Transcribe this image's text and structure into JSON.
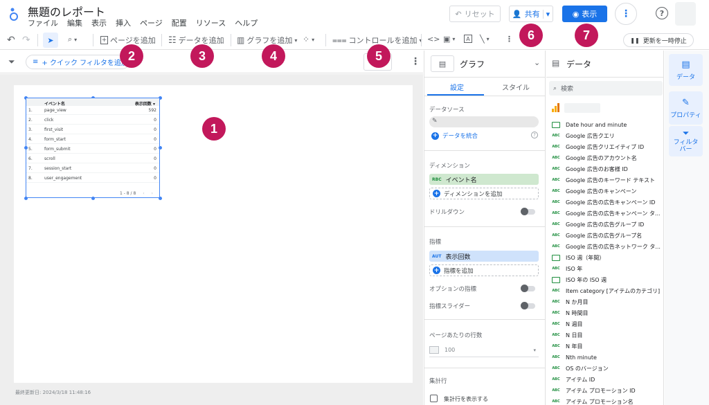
{
  "header": {
    "title": "無題のレポート",
    "menus": [
      "ファイル",
      "編集",
      "表示",
      "挿入",
      "ページ",
      "配置",
      "リソース",
      "ヘルプ"
    ],
    "reset_label": "リセット",
    "share_label": "共有",
    "view_label": "表示"
  },
  "toolbar": {
    "add_page": "ページを追加",
    "add_data": "データを追加",
    "add_chart": "グラフを追加",
    "add_control": "コントロールを追加",
    "pause_updates": "更新を一時停止"
  },
  "filterbar": {
    "quick_filter": "+ クイック フィルタを追加"
  },
  "canvas": {
    "last_updated": "最終更新日: 2024/3/18 11:48:16"
  },
  "table": {
    "headers": [
      "イベント名",
      "表示回数 ▾"
    ],
    "rows": [
      {
        "num": "1.",
        "name": "page_view",
        "value": "592"
      },
      {
        "num": "2.",
        "name": "click",
        "value": "0"
      },
      {
        "num": "3.",
        "name": "first_visit",
        "value": "0"
      },
      {
        "num": "4.",
        "name": "form_start",
        "value": "0"
      },
      {
        "num": "5.",
        "name": "form_submit",
        "value": "0"
      },
      {
        "num": "6.",
        "name": "scroll",
        "value": "0"
      },
      {
        "num": "7.",
        "name": "session_start",
        "value": "0"
      },
      {
        "num": "8.",
        "name": "user_engagement",
        "value": "0"
      }
    ],
    "pager": "1 - 8 / 8"
  },
  "badges": [
    "1",
    "2",
    "3",
    "4",
    "5",
    "6",
    "7"
  ],
  "properties": {
    "chart_type": "グラフ",
    "tab_setup": "設定",
    "tab_style": "スタイル",
    "data_source_label": "データソース",
    "blend_data": "データを統合",
    "dimension_label": "ディメンション",
    "dimension_type": "RBC",
    "dimension_value": "イベント名",
    "add_dimension": "ディメンションを追加",
    "drilldown": "ドリルダウン",
    "metric_label": "指標",
    "metric_type": "AUT",
    "metric_value": "表示回数",
    "add_metric": "指標を追加",
    "optional_metrics": "オプションの指標",
    "metric_slider": "指標スライダー",
    "rows_per_page_label": "ページあたりの行数",
    "rows_per_page_value": "100",
    "summary_row_label": "集計行",
    "show_summary_row": "集計行を表示する"
  },
  "data_panel": {
    "title": "データ",
    "search_placeholder": "検索",
    "fields": [
      {
        "type": "cal",
        "name": "Date hour and minute"
      },
      {
        "type": "ABC",
        "name": "Google 広告クエリ"
      },
      {
        "type": "ABC",
        "name": "Google 広告クリエイティブ ID"
      },
      {
        "type": "ABC",
        "name": "Google 広告のアカウント名"
      },
      {
        "type": "ABC",
        "name": "Google 広告のお客様 ID"
      },
      {
        "type": "ABC",
        "name": "Google 広告のキーワード テキスト"
      },
      {
        "type": "ABC",
        "name": "Google 広告のキャンペーン"
      },
      {
        "type": "ABC",
        "name": "Google 広告の広告キャンペーン ID"
      },
      {
        "type": "ABC",
        "name": "Google 広告の広告キャンペーン タ..."
      },
      {
        "type": "ABC",
        "name": "Google 広告の広告グループ ID"
      },
      {
        "type": "ABC",
        "name": "Google 広告の広告グループ名"
      },
      {
        "type": "ABC",
        "name": "Google 広告の広告ネットワーク タ..."
      },
      {
        "type": "cal",
        "name": "ISO 週（年間）"
      },
      {
        "type": "ABC",
        "name": "ISO 年"
      },
      {
        "type": "cal",
        "name": "ISO 年の ISO 週"
      },
      {
        "type": "ABC",
        "name": "Item category [アイテムのカテゴリ]"
      },
      {
        "type": "ABC",
        "name": "N か月目"
      },
      {
        "type": "ABC",
        "name": "N 時間目"
      },
      {
        "type": "ABC",
        "name": "N 週目"
      },
      {
        "type": "ABC",
        "name": "N 日目"
      },
      {
        "type": "ABC",
        "name": "N 年目"
      },
      {
        "type": "ABC",
        "name": "Nth minute"
      },
      {
        "type": "ABC",
        "name": "OS のバージョン"
      },
      {
        "type": "ABC",
        "name": "アイテム ID"
      },
      {
        "type": "ABC",
        "name": "アイテム プロモーション ID"
      },
      {
        "type": "ABC",
        "name": "アイテム プロモーション名"
      }
    ]
  },
  "rail": {
    "data": "データ",
    "properties": "プロパティ",
    "filter": "フィルタバー"
  },
  "colors": {
    "accent": "#1a73e8",
    "badge": "#c2185b",
    "dimension_chip": "#cfe8cf",
    "metric_chip": "#cfe2fb"
  }
}
